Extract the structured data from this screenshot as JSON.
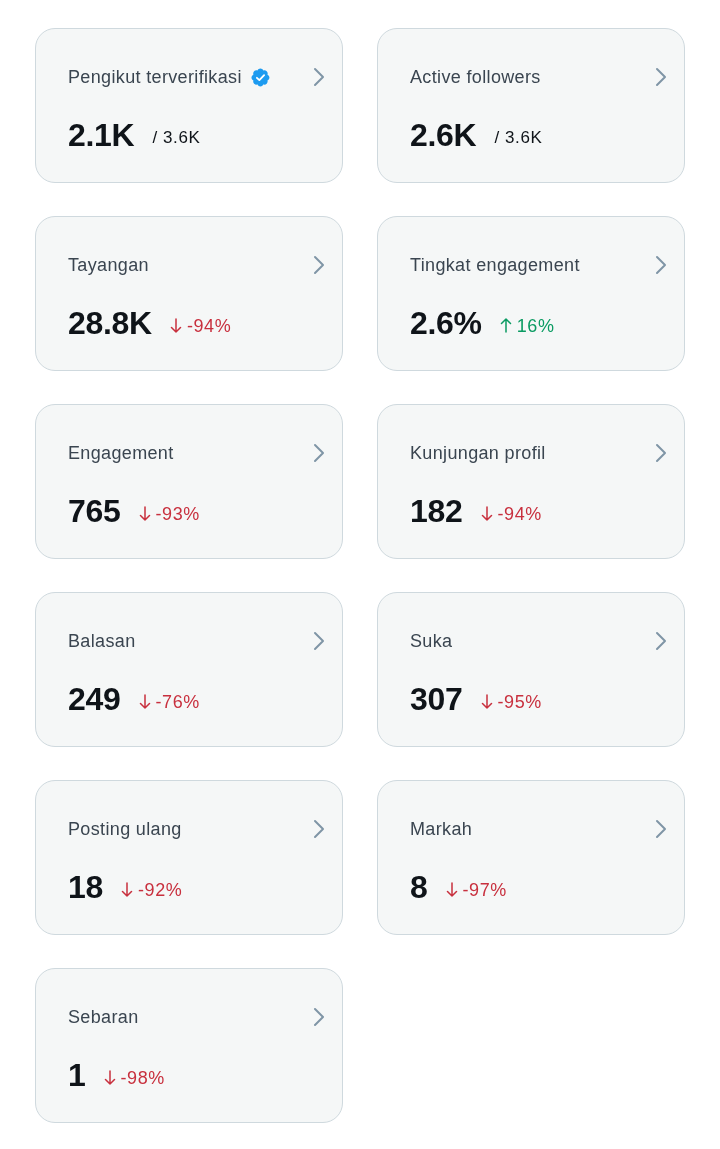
{
  "metrics": [
    {
      "kind": "ratio",
      "label": "Pengikut terverifikasi",
      "verified": true,
      "value": "2.1K",
      "total": "/ 3.6K"
    },
    {
      "kind": "ratio",
      "label": "Active followers",
      "verified": false,
      "value": "2.6K",
      "total": "/ 3.6K"
    },
    {
      "kind": "decrease",
      "label": "Tayangan",
      "verified": false,
      "value": "28.8K",
      "change": "-94%"
    },
    {
      "kind": "increase",
      "label": "Tingkat engagement",
      "verified": false,
      "value": "2.6%",
      "change": "16%"
    },
    {
      "kind": "decrease",
      "label": "Engagement",
      "verified": false,
      "value": "765",
      "change": "-93%"
    },
    {
      "kind": "decrease",
      "label": "Kunjungan profil",
      "verified": false,
      "value": "182",
      "change": "-94%"
    },
    {
      "kind": "decrease",
      "label": "Balasan",
      "verified": false,
      "value": "249",
      "change": "-76%"
    },
    {
      "kind": "decrease",
      "label": "Suka",
      "verified": false,
      "value": "307",
      "change": "-95%"
    },
    {
      "kind": "decrease",
      "label": "Posting ulang",
      "verified": false,
      "value": "18",
      "change": "-92%"
    },
    {
      "kind": "decrease",
      "label": "Markah",
      "verified": false,
      "value": "8",
      "change": "-97%"
    },
    {
      "kind": "decrease",
      "label": "Sebaran",
      "verified": false,
      "value": "1",
      "change": "-98%"
    }
  ]
}
